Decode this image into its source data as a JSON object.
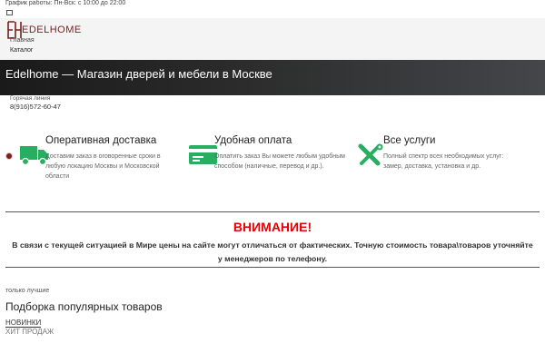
{
  "topbar": {
    "schedule": "График работы: Пн-Вск: с 10:00 до 22:00"
  },
  "header": {
    "logo_text": "EDELHOME",
    "nav": [
      {
        "label": "Главная"
      },
      {
        "label": "Каталог"
      }
    ]
  },
  "hero": {
    "title": "Edelhome — Магазин дверей и мебели в Москве"
  },
  "hotline": {
    "label": "Горячая линия",
    "phone": "8(916)572-60-47"
  },
  "features": [
    {
      "title": "Оперативная доставка",
      "text": "Доставим заказ в оговоренные сроки в любую локацию Москвы и Московской области",
      "icon": "truck-icon"
    },
    {
      "title": "Удобная оплата",
      "text": "Оплатить заказ Вы можете любым удобным способом (наличные, перевод и др.).",
      "icon": "credit-card-icon"
    },
    {
      "title": "Все услуги",
      "text": "Полный спектр всех необходимых услуг: замер, доставка, установка и др.",
      "icon": "tools-icon"
    }
  ],
  "notice": {
    "title": "ВНИМАНИЕ!",
    "text": "В связи с текущей ситуацией в Мире цены на сайте могут отличаться от фактических. Точную стоимость товара\\товаров уточняйте у менеджеров по телефону."
  },
  "products": {
    "eyebrow": "только лучшие",
    "title": "Подборка популярных товаров",
    "tabs": [
      {
        "label": "НОВИНКИ"
      },
      {
        "label": "ХИТ ПРОДАЖ"
      }
    ]
  },
  "colors": {
    "brand": "#7b1e1e",
    "icon_green": "#27ae60",
    "alert_red": "#e60000"
  }
}
